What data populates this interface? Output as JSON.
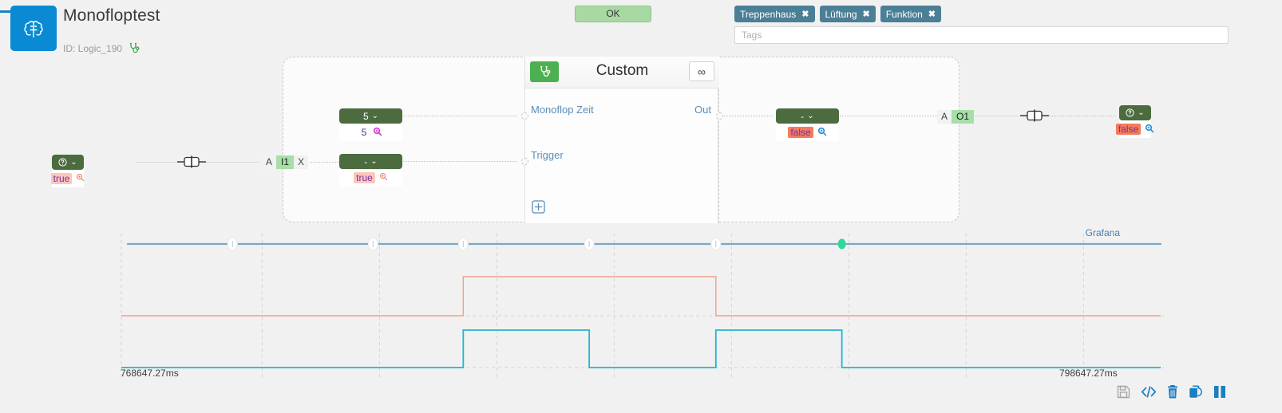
{
  "header": {
    "title": "Monofloptest",
    "id_label": "ID: Logic_190",
    "app_icon": "brain-icon",
    "status_icon": "stethoscope-icon",
    "ok_button": "OK",
    "tags": [
      {
        "label": "Treppenhaus",
        "remove_icon": "close-icon"
      },
      {
        "label": "Lüftung",
        "remove_icon": "close-icon"
      },
      {
        "label": "Funktion",
        "remove_icon": "close-icon"
      }
    ],
    "tags_input": {
      "value": "",
      "placeholder": "Tags"
    },
    "tag_color": "#4b7f96",
    "ok_color": "#a9d9a3"
  },
  "custom_block": {
    "title": "Custom",
    "debug_icon": "stethoscope-icon",
    "infinity_label": "∞",
    "inputs": [
      "Monoflop Zeit",
      "Trigger"
    ],
    "outputs": [
      "Out"
    ],
    "add_icon": "plus-box-icon",
    "accent": "#4caf50"
  },
  "nodes": {
    "input_left": {
      "head_label": "",
      "head_icon": "question-circle-icon",
      "chevron": "ˇ",
      "value": "true",
      "magnifier_icon": "magnifier-icon",
      "value_style": "bool-soft"
    },
    "monoflop_time": {
      "head_label": "5",
      "chevron": "ˇ",
      "value": "5",
      "magnifier_icon": "magnifier-icon",
      "value_style": "plain"
    },
    "trigger": {
      "head_label": "-",
      "chevron": "ˇ",
      "value": "true",
      "magnifier_icon": "magnifier-icon",
      "value_style": "bool-soft"
    },
    "out_value": {
      "head_label": "-",
      "chevron": "ˇ",
      "value": "false",
      "magnifier_icon": "magnifier-icon",
      "value_style": "bool-strong"
    },
    "output_right": {
      "head_label": "",
      "head_icon": "question-circle-icon",
      "chevron": "ˇ",
      "value": "false",
      "magnifier_icon": "magnifier-icon",
      "value_style": "bool-strong"
    }
  },
  "terminals": {
    "input": {
      "side": "A",
      "name": "I1",
      "suffix": "X"
    },
    "output": {
      "side": "A",
      "name": "O1",
      "suffix": ""
    }
  },
  "chart_data": {
    "type": "line",
    "title": "",
    "source_label": "Grafana",
    "xlabel": "",
    "ylabel": "",
    "x_start_label": "768647.27ms",
    "x_end_label": "798647.27ms",
    "x_start": 768647.27,
    "x_end": 798647.27,
    "grid": true,
    "gridlines_x": [
      768647.27,
      772895.0,
      776434.0,
      779973.0,
      783512.0,
      787051.0,
      790590.0,
      794129.0,
      797668.0
    ],
    "markers": {
      "color": "#7aa8c8",
      "active_color": "#2fd79a",
      "points": [
        {
          "x": 772000.0,
          "active": false
        },
        {
          "x": 776240.0,
          "active": false
        },
        {
          "x": 778960.0,
          "active": false
        },
        {
          "x": 782760.0,
          "active": false
        },
        {
          "x": 786580.0,
          "active": false
        },
        {
          "x": 790380.0,
          "active": true
        }
      ]
    },
    "series": [
      {
        "name": "Trigger",
        "color": "#f0a08a",
        "style": "step",
        "low": 0,
        "high": 1,
        "transitions": [
          {
            "x": 768647.27,
            "value": 0
          },
          {
            "x": 778960.0,
            "value": 1
          },
          {
            "x": 786580.0,
            "value": 0
          },
          {
            "x": 790380.0,
            "value": 0
          }
        ]
      },
      {
        "name": "Out",
        "color": "#21b5d4",
        "style": "step",
        "low": 0,
        "high": 1,
        "transitions": [
          {
            "x": 768647.27,
            "value": 0
          },
          {
            "x": 778960.0,
            "value": 1
          },
          {
            "x": 782760.0,
            "value": 0
          },
          {
            "x": 786580.0,
            "value": 1
          },
          {
            "x": 790380.0,
            "value": 0
          }
        ]
      }
    ]
  },
  "footer": {
    "buttons": [
      {
        "name": "save-icon",
        "enabled": false
      },
      {
        "name": "code-icon",
        "enabled": true
      },
      {
        "name": "trash-icon",
        "enabled": true
      },
      {
        "name": "copy-icon",
        "enabled": true
      },
      {
        "name": "pause-icon",
        "enabled": true
      }
    ],
    "accent": "#1a7fc1"
  }
}
